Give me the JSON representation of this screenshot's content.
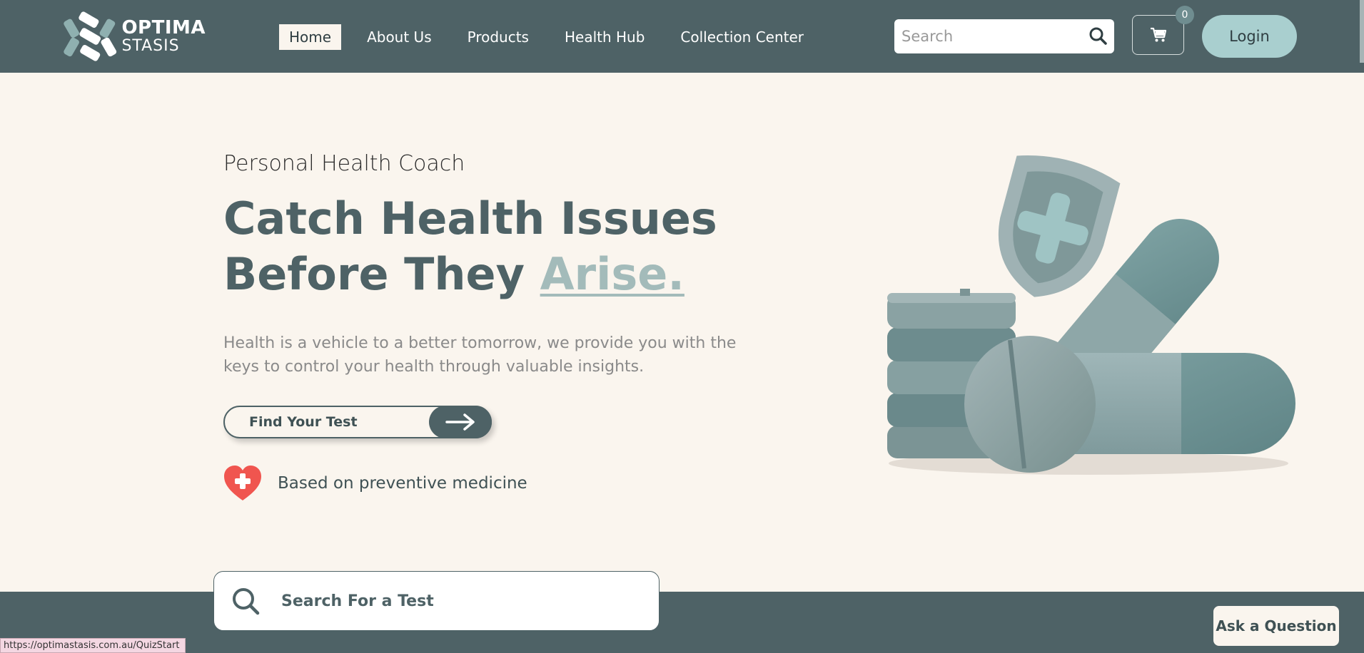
{
  "header": {
    "logo": {
      "line1": "OPTIMA",
      "line2": "STASIS"
    },
    "nav": [
      {
        "label": "Home",
        "active": true
      },
      {
        "label": "About Us",
        "active": false
      },
      {
        "label": "Products",
        "active": false
      },
      {
        "label": "Health Hub",
        "active": false
      },
      {
        "label": "Collection Center",
        "active": false
      }
    ],
    "search": {
      "placeholder": "Search",
      "value": ""
    },
    "cart": {
      "count": "0",
      "icon": "cart-icon"
    },
    "login_label": "Login"
  },
  "hero": {
    "eyebrow": "Personal Health Coach",
    "headline_line1": "Catch Health Issues",
    "headline_line2_prefix": "Before They ",
    "headline_accent": "Arise.",
    "lead": "Health is a vehicle to a better tomorrow, we provide you with the keys to control your health through valuable insights.",
    "cta_label": "Find Your Test",
    "badge_text": "Based on preventive medicine"
  },
  "test_search": {
    "placeholder": "Search For a Test",
    "value": ""
  },
  "ask_label": "Ask a Question",
  "status_url": "https://optimastasis.com.au/QuizStart",
  "colors": {
    "header_bg": "#4e6266",
    "page_bg": "#faf5ee",
    "accent": "#a3bbba",
    "login_bg": "#a9cfcf",
    "heart": "#f0554f"
  }
}
